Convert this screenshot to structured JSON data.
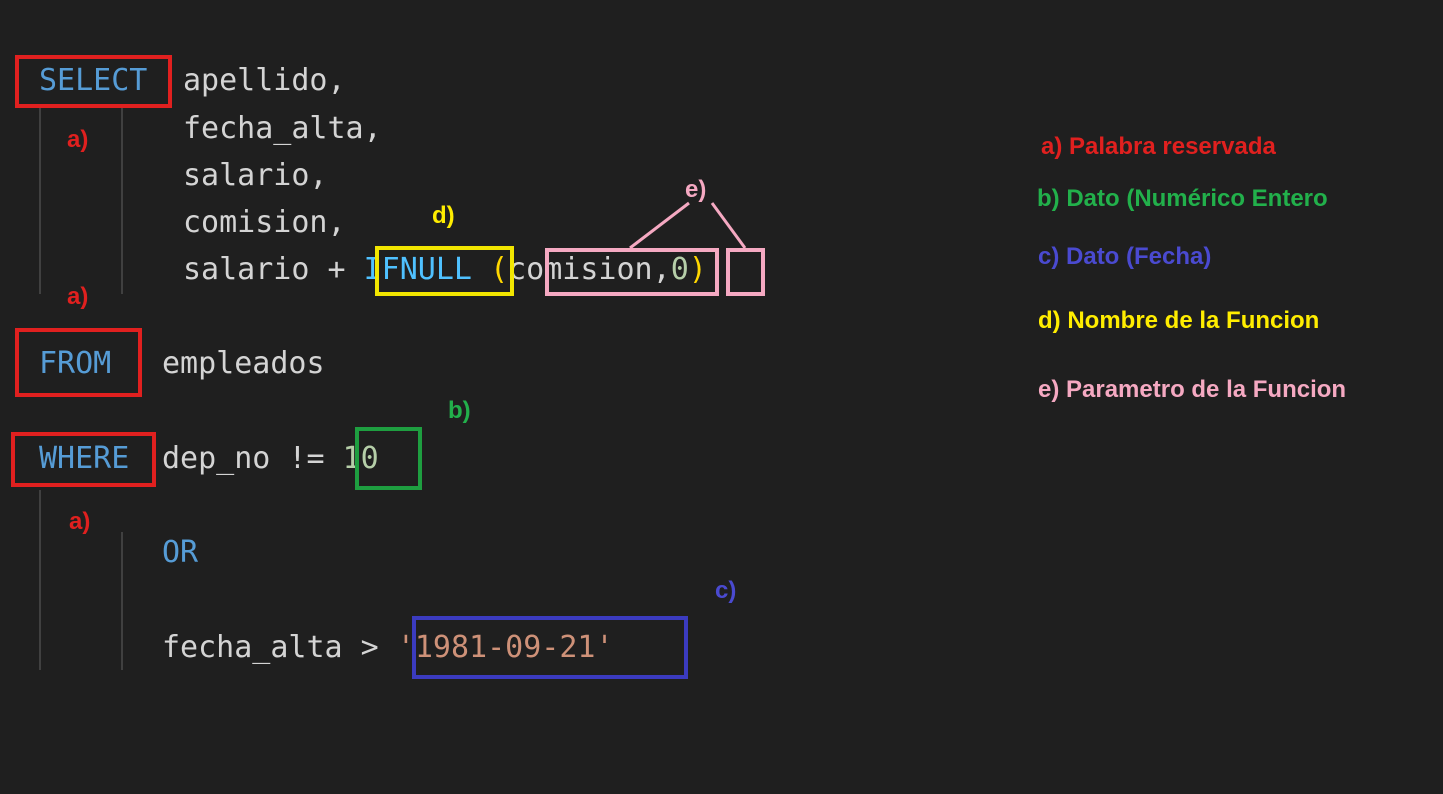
{
  "code": {
    "select_kw": "SELECT",
    "select_cols": [
      "apellido,",
      "fecha_alta,",
      "salario,",
      "comision,"
    ],
    "salario_plus": "salario + ",
    "ifnull_fn": "IFNULL",
    "open_paren": "(",
    "param_comision": "comision",
    "comma": ",",
    "param_zero": "0",
    "close_paren": ")",
    "from_kw": "FROM",
    "from_table": "empleados",
    "where_kw": "WHERE",
    "where_cond": "dep_no != ",
    "where_value": "10",
    "or_kw": "OR",
    "date_cond": "fecha_alta > ",
    "date_value": "'1981-09-21'"
  },
  "markers": {
    "a": "a)",
    "b": "b)",
    "c": "c)",
    "d": "d)",
    "e": "e)"
  },
  "legend": {
    "a": "a) Palabra reservada",
    "b": "b) Dato (Numérico Entero",
    "c": "c) Dato (Fecha)",
    "d": "d) Nombre de la Funcion",
    "e": "e) Parametro de la Funcion"
  },
  "colors": {
    "reserved_word": "#e0201f",
    "integer_data": "#22b04b",
    "date_data": "#4a4ad0",
    "function_name": "#ffed00",
    "function_param": "#f5a9c2"
  }
}
